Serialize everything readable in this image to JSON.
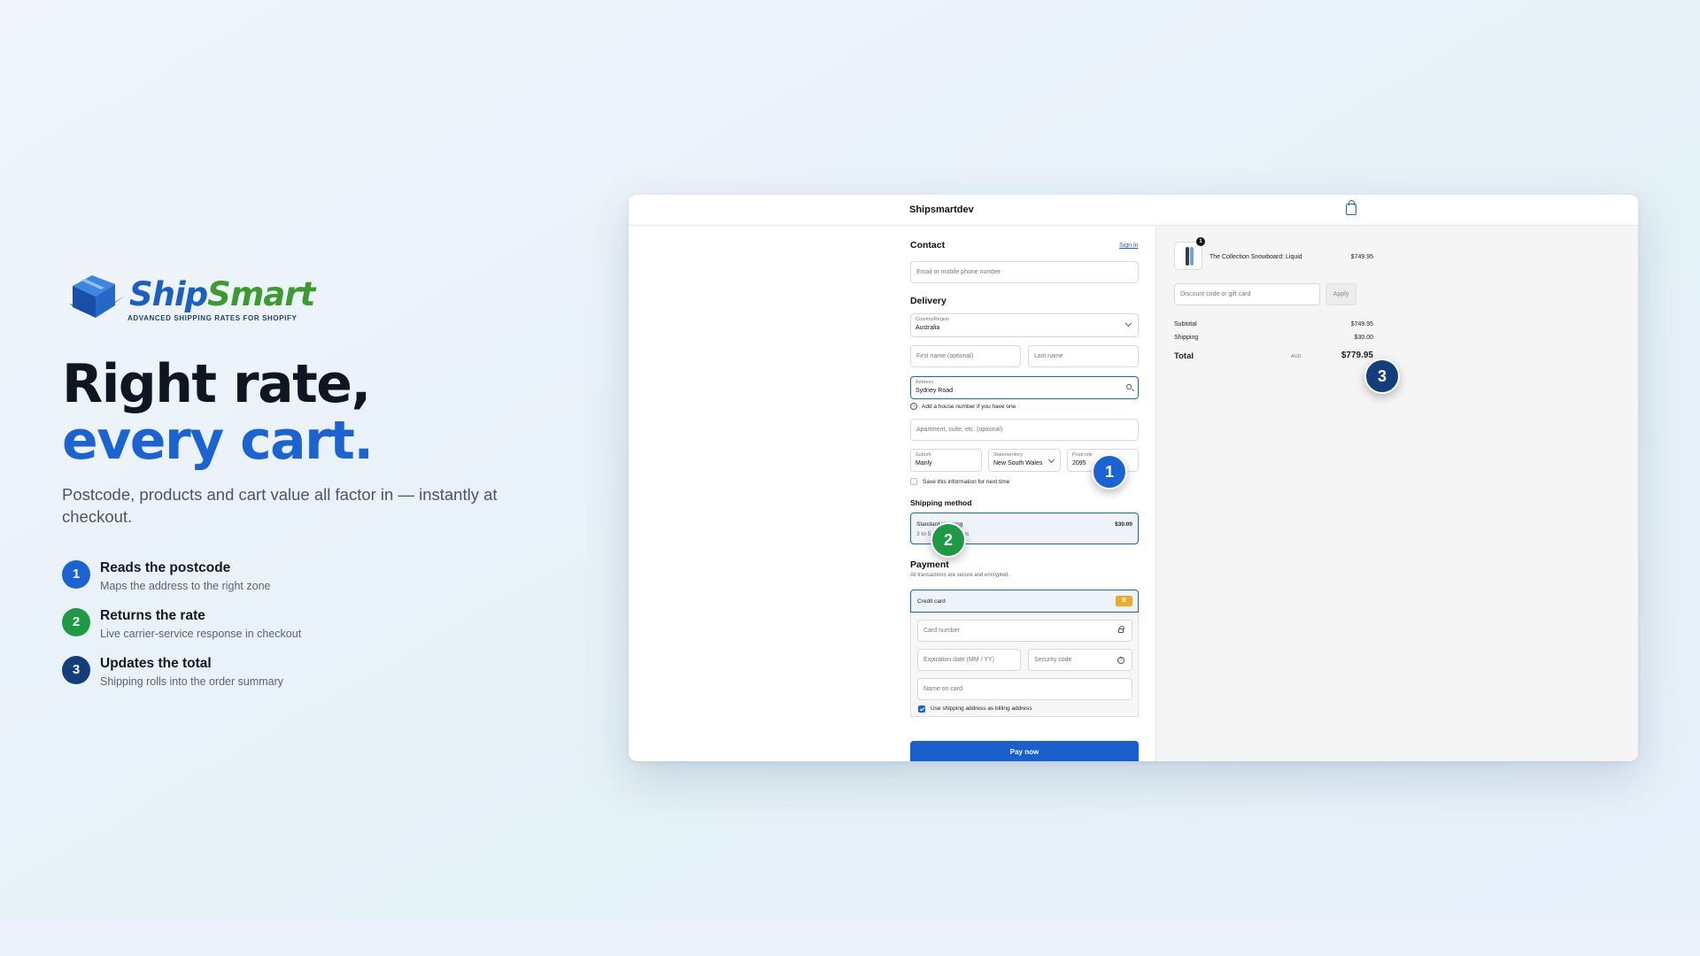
{
  "brand": {
    "logo_word_ship": "Ship",
    "logo_word_smart": "Smart",
    "tagline": "ADVANCED SHIPPING RATES FOR SHOPIFY"
  },
  "hero": {
    "headline_line1": "Right rate,",
    "headline_line2": "every cart.",
    "subtext": "Postcode, products and cart value all factor in — instantly at checkout."
  },
  "steps": [
    {
      "number": "1",
      "title": "Reads the postcode",
      "description": "Maps the address to the right zone",
      "color": "#1b63d2"
    },
    {
      "number": "2",
      "title": "Returns the rate",
      "description": "Live carrier-service response in checkout",
      "color": "#1e9a45"
    },
    {
      "number": "3",
      "title": "Updates the total",
      "description": "Shipping rolls into the order summary",
      "color": "#123e7c"
    }
  ],
  "checkout": {
    "shop_name": "Shipsmartdev",
    "contact": {
      "title": "Contact",
      "sign_in": "Sign in",
      "email_placeholder": "Email or mobile phone number"
    },
    "delivery": {
      "title": "Delivery",
      "country_label": "Country/Region",
      "country_value": "Australia",
      "first_name_placeholder": "First name (optional)",
      "last_name_placeholder": "Last name",
      "address_label": "Address",
      "address_value": "Sydney Road",
      "address_hint": "Add a house number if you have one",
      "apartment_placeholder": "Apartment, suite, etc. (optional)",
      "suburb_label": "Suburb",
      "suburb_value": "Manly",
      "state_label": "State/territory",
      "state_value": "New South Wales",
      "postcode_label": "Postcode",
      "postcode_value": "2095",
      "save_info": "Save this information for next time"
    },
    "shipping_method": {
      "title": "Shipping method",
      "name": "Standard shipping",
      "eta": "3 to 5 business days",
      "price": "$30.00"
    },
    "payment": {
      "title": "Payment",
      "subtitle": "All transactions are secure and encrypted.",
      "method": "Credit card",
      "card_badge": "B",
      "card_number_placeholder": "Card number",
      "expiry_placeholder": "Expiration date (MM / YY)",
      "security_placeholder": "Security code",
      "name_placeholder": "Name on card",
      "billing_same": "Use shipping address as billing address",
      "pay_button": "Pay now"
    },
    "summary": {
      "qty": "1",
      "product_name": "The Collection Snowboard: Liquid",
      "product_price": "$749.95",
      "discount_placeholder": "Discount code or gift card",
      "apply": "Apply",
      "subtotal_label": "Subtotal",
      "subtotal_value": "$749.95",
      "shipping_label": "Shipping",
      "shipping_value": "$30.00",
      "total_label": "Total",
      "currency": "AUD",
      "total_value": "$779.95"
    }
  },
  "callouts": [
    {
      "number": "1",
      "color": "#1b63d2"
    },
    {
      "number": "2",
      "color": "#1e9a45"
    },
    {
      "number": "3",
      "color": "#123e7c"
    }
  ]
}
